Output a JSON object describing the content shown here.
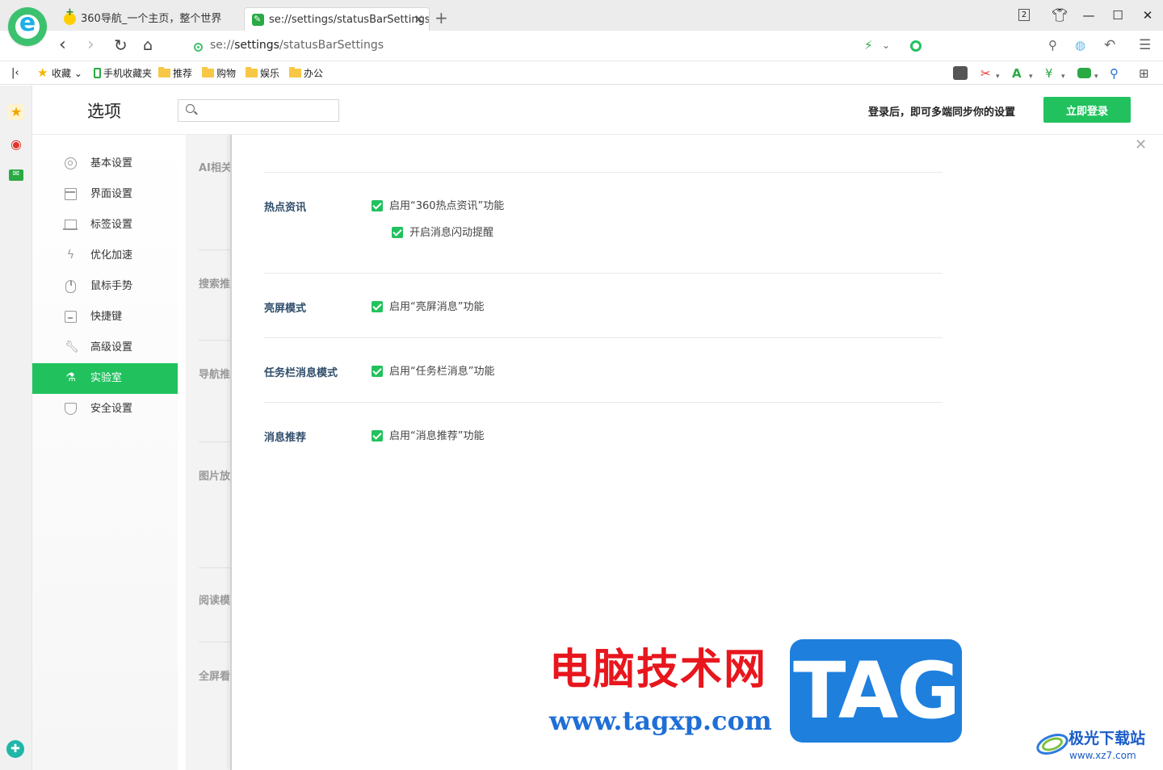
{
  "tabs": [
    {
      "title": "360导航_一个主页，整个世界",
      "active": false
    },
    {
      "title": "se://settings/statusBarSettings",
      "active": true
    }
  ],
  "window": {
    "tab_count": "2"
  },
  "address": {
    "scheme": "se://",
    "host": "settings",
    "path": "/statusBarSettings"
  },
  "bookmarks": {
    "collapse_label": "收藏",
    "items": [
      "手机收藏夹",
      "推荐",
      "购物",
      "娱乐",
      "办公"
    ]
  },
  "settings": {
    "title": "选项",
    "search_placeholder": "",
    "sync_text": "登录后，即可多端同步你的设置",
    "login_button": "立即登录"
  },
  "nav": {
    "items": [
      "基本设置",
      "界面设置",
      "标签设置",
      "优化加速",
      "鼠标手势",
      "快捷键",
      "高级设置",
      "实验室",
      "安全设置"
    ],
    "active_index": 7
  },
  "background_sections": [
    "AI相关",
    "搜索推",
    "导航推",
    "图片放",
    "阅读模",
    "全屏看"
  ],
  "lab": {
    "sections": [
      {
        "title": "热点资讯",
        "options": [
          "启用“360热点资讯”功能",
          "开启消息闪动提醒"
        ]
      },
      {
        "title": "亮屏模式",
        "options": [
          "启用“亮屏消息”功能"
        ]
      },
      {
        "title": "任务栏消息模式",
        "options": [
          "启用“任务栏消息”功能"
        ]
      },
      {
        "title": "消息推荐",
        "options": [
          "启用“消息推荐”功能"
        ]
      }
    ]
  },
  "watermark": {
    "cn": "电脑技术网",
    "url": "www.tagxp.com",
    "tag": "TAG",
    "site2_cn": "极光下载站",
    "site2_url": "www.xz7.com"
  },
  "colors": {
    "accent": "#21c25e",
    "title_blue": "#2f4d6a",
    "watermark_red": "#e8161d",
    "watermark_blue": "#1e7fdd"
  }
}
